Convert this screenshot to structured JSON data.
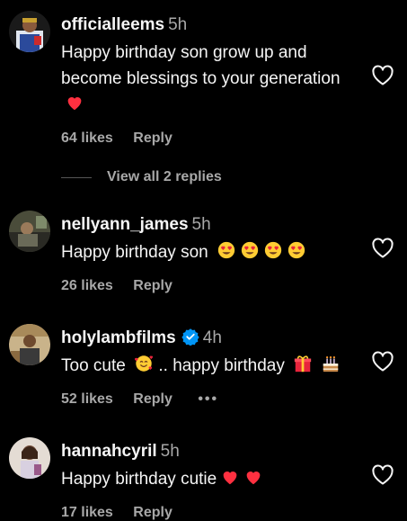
{
  "comments": [
    {
      "username": "officialleems",
      "time": "5h",
      "text": "Happy birthday son grow up and become blessings to your generation",
      "likes": "64 likes",
      "reply": "Reply",
      "avatar": "avatar-photo",
      "emojis": [
        "red-heart-emoji"
      ]
    },
    {
      "username": "nellyann_james",
      "time": "5h",
      "text": "Happy birthday son",
      "likes": "26 likes",
      "reply": "Reply",
      "avatar": "avatar-photo",
      "emojis": [
        "heart-eyes-emoji",
        "heart-eyes-emoji",
        "heart-eyes-emoji",
        "heart-eyes-emoji"
      ]
    },
    {
      "username": "holylambfilms",
      "verified": true,
      "time": "4h",
      "text": "Too cute",
      "text2": ".. happy birthday",
      "likes": "52 likes",
      "reply": "Reply",
      "more": "•••",
      "avatar": "avatar-photo",
      "emojis": [
        "smiling-face-with-hearts-emoji",
        "gift-emoji",
        "birthday-cake-emoji"
      ]
    },
    {
      "username": "hannahcyril",
      "time": "5h",
      "text": "Happy birthday cutie",
      "likes": "17 likes",
      "reply": "Reply",
      "avatar": "avatar-photo",
      "emojis": [
        "red-heart-emoji",
        "red-heart-emoji"
      ]
    }
  ],
  "view_replies": "View all 2 replies",
  "icons": {
    "like": "heart-outline-icon",
    "verified": "verified-badge-icon"
  },
  "colors": {
    "background": "#000000",
    "text": "#f5f5f5",
    "muted": "#a8a8a8",
    "verified": "#0095f6",
    "heart": "#ff3040"
  }
}
